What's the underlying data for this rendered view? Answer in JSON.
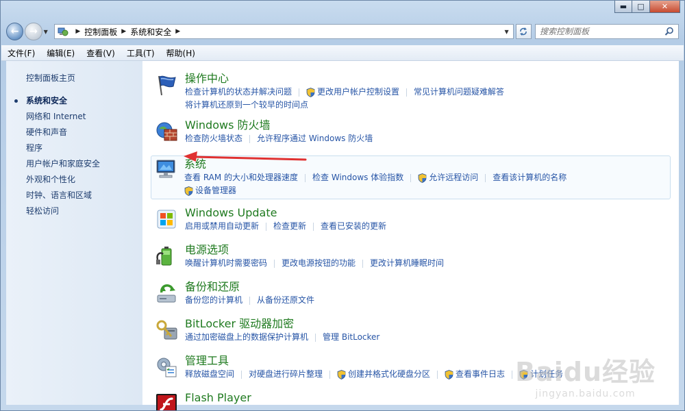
{
  "window": {
    "minimize_glyph": "▬",
    "maximize_glyph": "□",
    "close_glyph": "✕"
  },
  "address_bar": {
    "breadcrumbs": [
      "控制面板",
      "系统和安全"
    ],
    "search_placeholder": "搜索控制面板"
  },
  "menubar": [
    "文件(F)",
    "编辑(E)",
    "查看(V)",
    "工具(T)",
    "帮助(H)"
  ],
  "sidebar": {
    "home": "控制面板主页",
    "items": [
      "系统和安全",
      "网络和 Internet",
      "硬件和声音",
      "程序",
      "用户帐户和家庭安全",
      "外观和个性化",
      "时钟、语言和区域",
      "轻松访问"
    ],
    "current_index": 0
  },
  "categories": [
    {
      "title": "操作中心",
      "icon": "action-center-flag-icon",
      "lines": [
        [
          {
            "text": "检查计算机的状态并解决问题",
            "shield": false
          },
          {
            "text": "更改用户帐户控制设置",
            "shield": true
          },
          {
            "text": "常见计算机问题疑难解答",
            "shield": false
          }
        ],
        [
          {
            "text": "将计算机还原到一个较早的时间点",
            "shield": false
          }
        ]
      ]
    },
    {
      "title": "Windows 防火墙",
      "icon": "firewall-icon",
      "lines": [
        [
          {
            "text": "检查防火墙状态",
            "shield": false
          },
          {
            "text": "允许程序通过 Windows 防火墙",
            "shield": false
          }
        ]
      ]
    },
    {
      "title": "系统",
      "icon": "system-computer-icon",
      "highlight": true,
      "lines": [
        [
          {
            "text": "查看 RAM 的大小和处理器速度",
            "shield": false
          },
          {
            "text": "检查 Windows 体验指数",
            "shield": false
          },
          {
            "text": "允许远程访问",
            "shield": true
          },
          {
            "text": "查看该计算机的名称",
            "shield": false
          }
        ],
        [
          {
            "text": "设备管理器",
            "shield": true
          }
        ]
      ]
    },
    {
      "title": "Windows Update",
      "icon": "windows-update-icon",
      "lines": [
        [
          {
            "text": "启用或禁用自动更新",
            "shield": false
          },
          {
            "text": "检查更新",
            "shield": false
          },
          {
            "text": "查看已安装的更新",
            "shield": false
          }
        ]
      ]
    },
    {
      "title": "电源选项",
      "icon": "power-options-icon",
      "lines": [
        [
          {
            "text": "唤醒计算机时需要密码",
            "shield": false
          },
          {
            "text": "更改电源按钮的功能",
            "shield": false
          },
          {
            "text": "更改计算机睡眠时间",
            "shield": false
          }
        ]
      ]
    },
    {
      "title": "备份和还原",
      "icon": "backup-restore-icon",
      "lines": [
        [
          {
            "text": "备份您的计算机",
            "shield": false
          },
          {
            "text": "从备份还原文件",
            "shield": false
          }
        ]
      ]
    },
    {
      "title": "BitLocker 驱动器加密",
      "icon": "bitlocker-key-icon",
      "lines": [
        [
          {
            "text": "通过加密磁盘上的数据保护计算机",
            "shield": false
          },
          {
            "text": "管理 BitLocker",
            "shield": false
          }
        ]
      ]
    },
    {
      "title": "管理工具",
      "icon": "admin-tools-icon",
      "lines": [
        [
          {
            "text": "释放磁盘空间",
            "shield": false
          },
          {
            "text": "对硬盘进行碎片整理",
            "shield": false
          },
          {
            "text": "创建并格式化硬盘分区",
            "shield": true
          },
          {
            "text": "查看事件日志",
            "shield": true
          },
          {
            "text": "计划任务",
            "shield": true
          }
        ]
      ]
    },
    {
      "title": "Flash Player",
      "icon": "flash-player-icon",
      "lines": []
    }
  ],
  "watermark": {
    "brand": "Baidu经验",
    "url": "jingyan.baidu.com"
  },
  "colors": {
    "category_title": "#1f7a1f",
    "link": "#2755a6",
    "annotation_arrow": "#e03131"
  }
}
